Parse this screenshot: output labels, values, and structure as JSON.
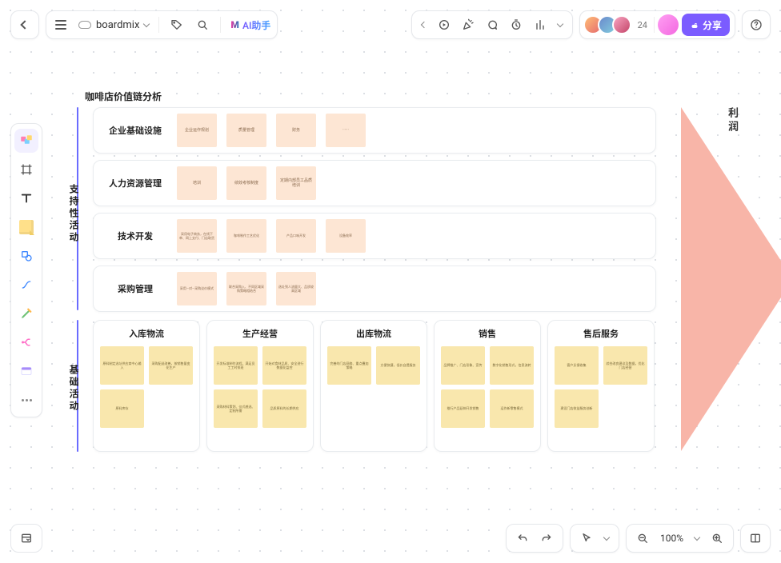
{
  "header": {
    "document_title": "boardmix",
    "ai_label": "AI助手",
    "collab_count": "24",
    "share_label": "分享"
  },
  "bottombar": {
    "zoom": "100%"
  },
  "diagram": {
    "title": "咖啡店价值链分析",
    "support_label": "支持性活动",
    "base_label": "基础活动",
    "margin_label": "利润",
    "support_rows": [
      {
        "label": "企业基础设施",
        "notes": [
          "企业运作规划",
          "质量管理",
          "财务",
          "······"
        ]
      },
      {
        "label": "人力资源管理",
        "notes": [
          "培训",
          "绩效考核制度",
          "定期内部员工品质培训"
        ]
      },
      {
        "label": "技术开发",
        "notes": [
          "采用电子商务，在线下单、网上支付、门店取货",
          "咖啡制作工艺优化",
          "产品口味开发",
          "设备效率"
        ]
      },
      {
        "label": "采购管理",
        "notes": [
          "采用—对—采购议价模式",
          "联合采购入、不同区域采购策略相结合",
          "选址到人流量大、品质较高区域"
        ]
      }
    ],
    "primary": [
      {
        "label": "入库物流",
        "notes": [
          "原料制定选址供应商中心输入",
          "采购配送改善，按销售量变化生产",
          "原料库存"
        ]
      },
      {
        "label": "生产经营",
        "notes": [
          "开发标准制作流程，满足员工工时排班",
          "开始对食材品质、安全进行数据化监控",
          "采购材料策划、仪式感选、定制所需",
          "品质原料的长期供应"
        ]
      },
      {
        "label": "出库物流",
        "notes": [
          "完善的门店网络、重点叠加策略",
          "方便快捷，低价自提服务"
        ]
      },
      {
        "label": "销售",
        "notes": [
          "品牌推广、门店形象、宣传",
          "数字化销售形式，信息流转",
          "推行产品延伸开发销售",
          "运作新零售模式"
        ]
      },
      {
        "label": "售后服务",
        "notes": [
          "客户反馈收集",
          "综合改良建议及数据，优化门店经营",
          "建设门店收益服务创新"
        ]
      }
    ]
  }
}
